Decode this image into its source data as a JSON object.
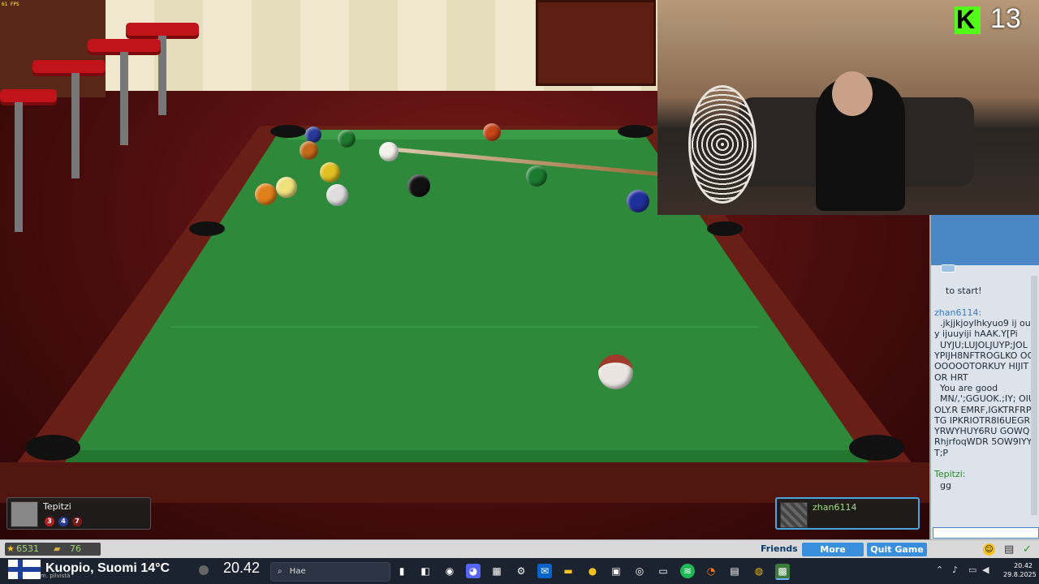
{
  "overlay": {
    "fps": "61 FPS"
  },
  "stream": {
    "viewer_count": "13"
  },
  "chat": {
    "lines": [
      {
        "name": "",
        "text": "to start!"
      },
      {
        "name": "zhan6114:",
        "text": "  .jkjjkjoylhkyuo9 ij ouy ijuuyiji hAAK.Y[Pi\n  UYJU;LUJOLJUYP;JOL YPIJH8NFTROGLKO OOOOOOOTORKUY HIJITOR HRT\n  You are good\n  MN/,';GGUOK.;IY; OIUOLY.R EMRF,IGKTRFRPTG IPKRIOTR8I6UEGR YRWYHUY6RU GOWQRhjrfoqWDR 5OW9IYYT;P"
      },
      {
        "name": "Tepitzi:",
        "text": "  gg"
      }
    ]
  },
  "players": {
    "left": {
      "name": "Tepitzi",
      "balls": [
        "3",
        "4",
        "7"
      ]
    },
    "right": {
      "name": "zhan6114"
    }
  },
  "footer": {
    "coins": "6531",
    "chips": "76",
    "friends": "Friends",
    "more": "More",
    "quit": "Quit Game"
  },
  "taskbar": {
    "weather": "Kuopio, Suomi 14°C",
    "weather_sub": "m. pilvistä",
    "clock_widget": "20.42",
    "search_placeholder": "Hae",
    "time": "20.42",
    "date": "29.8.2025"
  },
  "colors": {
    "felt": "#2e8a3a",
    "rail": "#6a1f16",
    "chat_header": "#4a87c4",
    "accent": "#3a8fdc"
  }
}
